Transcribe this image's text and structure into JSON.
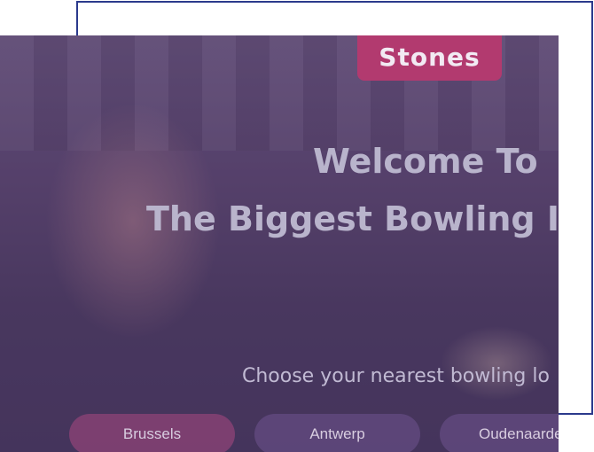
{
  "logo": {
    "text": "Stones"
  },
  "hero": {
    "welcome": "Welcome To",
    "headline": "The Biggest Bowling In",
    "subhead": "Choose your nearest bowling lo"
  },
  "locations": [
    {
      "label": "Brussels"
    },
    {
      "label": "Antwerp"
    },
    {
      "label": "Oudenaarde"
    }
  ],
  "colors": {
    "frame_border": "#2b3a8c",
    "logo_badge": "#b23a6f",
    "overlay": "#5c476f",
    "heading_text": "#b9b4cc"
  }
}
